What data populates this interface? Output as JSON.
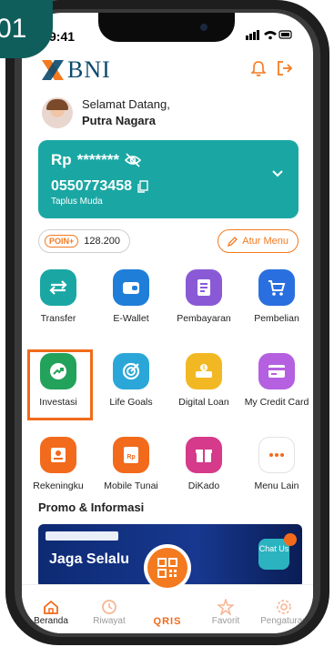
{
  "step_badge": "01",
  "status_bar": {
    "time": "9:41",
    "icons": "❙❙❙ ◔ ▭"
  },
  "header": {
    "brand": "BNI",
    "bell_icon": "bell-icon",
    "logout_icon": "logout-icon"
  },
  "greeting": {
    "hello": "Selamat Datang,",
    "name": "Putra Nagara"
  },
  "account": {
    "currency": "Rp",
    "balance_masked": "*******",
    "number": "0550773458",
    "type": "Taplus Muda"
  },
  "poin": {
    "label": "POIN+",
    "value": "128.200"
  },
  "menu_button": "Atur Menu",
  "menu": [
    [
      {
        "label": "Transfer",
        "color": "#1aa7a4",
        "icon": "transfer-icon"
      },
      {
        "label": "E-Wallet",
        "color": "#1f7ed8",
        "icon": "wallet-icon"
      },
      {
        "label": "Pembayaran",
        "color": "#8a5ad6",
        "icon": "bill-icon"
      },
      {
        "label": "Pembelian",
        "color": "#2a6fe0",
        "icon": "cart-icon"
      }
    ],
    [
      {
        "label": "Investasi",
        "color": "#22a25a",
        "icon": "investment-icon"
      },
      {
        "label": "Life Goals",
        "color": "#2aa7d8",
        "icon": "target-icon"
      },
      {
        "label": "Digital Loan",
        "color": "#f2b824",
        "icon": "loan-icon"
      },
      {
        "label": "My Credit Card",
        "color": "#b460e0",
        "icon": "credit-card-icon"
      }
    ],
    [
      {
        "label": "Rekeningku",
        "color": "#f26a1b",
        "icon": "account-icon"
      },
      {
        "label": "Mobile Tunai",
        "color": "#f26a1b",
        "icon": "atm-icon"
      },
      {
        "label": "DiKado",
        "color": "#d63a8a",
        "icon": "gift-icon"
      },
      {
        "label": "Menu Lain",
        "color": "#ffffff",
        "icon": "more-icon"
      }
    ]
  ],
  "promo": {
    "title": "Promo & Informasi",
    "banner_text": "Jaga Selalu"
  },
  "chat": {
    "label": "Chat Us"
  },
  "bottom_nav": [
    {
      "label": "Beranda",
      "icon": "home-icon",
      "active": true
    },
    {
      "label": "Riwayat",
      "icon": "history-icon",
      "active": false
    },
    {
      "label": "QRIS",
      "icon": "qris-icon",
      "active": false
    },
    {
      "label": "Favorit",
      "icon": "star-icon",
      "active": false
    },
    {
      "label": "Pengaturan",
      "icon": "settings-icon",
      "active": false
    }
  ],
  "colors": {
    "brand_orange": "#f47a20",
    "brand_teal": "#1aa7a4",
    "highlight": "#f26a1b"
  }
}
